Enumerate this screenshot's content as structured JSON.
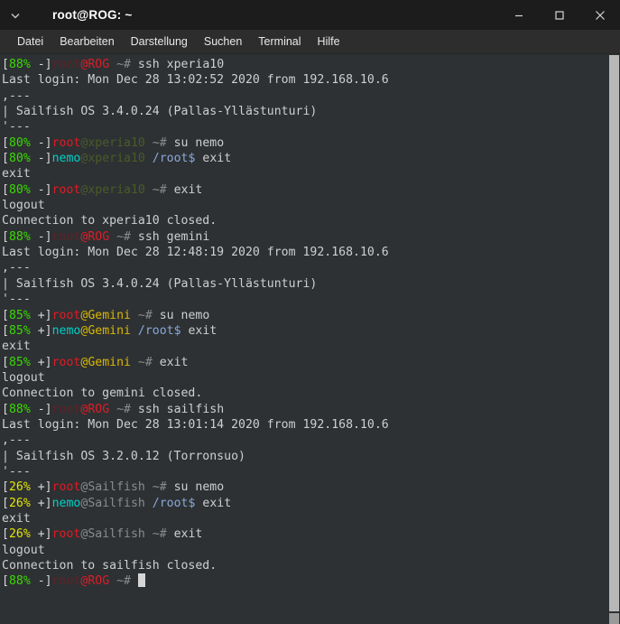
{
  "window": {
    "title": "root@ROG: ~",
    "chevron_icon": "chevron-down-icon",
    "controls": [
      {
        "name": "minimize-button",
        "icon": "minimize-icon"
      },
      {
        "name": "maximize-button",
        "icon": "maximize-icon"
      },
      {
        "name": "close-button",
        "icon": "close-icon"
      }
    ]
  },
  "menubar": {
    "items": [
      {
        "label": "Datei"
      },
      {
        "label": "Bearbeiten"
      },
      {
        "label": "Darstellung"
      },
      {
        "label": "Suchen"
      },
      {
        "label": "Terminal"
      },
      {
        "label": "Hilfe"
      }
    ]
  },
  "terminal": {
    "lines": {
      "l01": {
        "bracket_open": "[",
        "pct": "88%",
        "sep": " -]",
        "user": "root",
        "host": "@ROG",
        "path": " ~# ",
        "cmd": "ssh xperia10"
      },
      "l02": "Last login: Mon Dec 28 13:02:52 2020 from 192.168.10.6",
      "l03": ",---",
      "l04": "| Sailfish OS 3.4.0.24 (Pallas-Yllästunturi)",
      "l05": "'---",
      "l06": {
        "bracket_open": "[",
        "pct": "80%",
        "sep": " -]",
        "user": "root",
        "host": "@xperia10",
        "path": " ~# ",
        "cmd": "su nemo"
      },
      "l07": {
        "bracket_open": "[",
        "pct": "80%",
        "sep": " -]",
        "user": "nemo",
        "host": "@xperia10",
        "path": " /root$ ",
        "cmd": "exit"
      },
      "l08": "exit",
      "l09": {
        "bracket_open": "[",
        "pct": "80%",
        "sep": " -]",
        "user": "root",
        "host": "@xperia10",
        "path": " ~# ",
        "cmd": "exit"
      },
      "l10": "logout",
      "l11": "Connection to xperia10 closed.",
      "l12": {
        "bracket_open": "[",
        "pct": "88%",
        "sep": " -]",
        "user": "root",
        "host": "@ROG",
        "path": " ~# ",
        "cmd": "ssh gemini"
      },
      "l13": "Last login: Mon Dec 28 12:48:19 2020 from 192.168.10.6",
      "l14": ",---",
      "l15": "| Sailfish OS 3.4.0.24 (Pallas-Yllästunturi)",
      "l16": "'---",
      "l17": {
        "bracket_open": "[",
        "pct": "85%",
        "sep": " +]",
        "user": "root",
        "host": "@Gemini",
        "path": " ~# ",
        "cmd": "su nemo"
      },
      "l18": {
        "bracket_open": "[",
        "pct": "85%",
        "sep": " +]",
        "user": "nemo",
        "host": "@Gemini",
        "path": " /root$ ",
        "cmd": "exit"
      },
      "l19": "exit",
      "l20": {
        "bracket_open": "[",
        "pct": "85%",
        "sep": " +]",
        "user": "root",
        "host": "@Gemini",
        "path": " ~# ",
        "cmd": "exit"
      },
      "l21": "logout",
      "l22": "Connection to gemini closed.",
      "l23": {
        "bracket_open": "[",
        "pct": "88%",
        "sep": " -]",
        "user": "root",
        "host": "@ROG",
        "path": " ~# ",
        "cmd": "ssh sailfish"
      },
      "l24": "Last login: Mon Dec 28 13:01:14 2020 from 192.168.10.6",
      "l25": ",---",
      "l26": "| Sailfish OS 3.2.0.12 (Torronsuo)",
      "l27": "'---",
      "l28": {
        "bracket_open": "[",
        "pct": "26%",
        "sep": " +]",
        "user": "root",
        "host": "@Sailfish",
        "path": " ~# ",
        "cmd": "su nemo"
      },
      "l29": {
        "bracket_open": "[",
        "pct": "26%",
        "sep": " +]",
        "user": "nemo",
        "host": "@Sailfish",
        "path": " /root$ ",
        "cmd": "exit"
      },
      "l30": "exit",
      "l31": {
        "bracket_open": "[",
        "pct": "26%",
        "sep": " +]",
        "user": "root",
        "host": "@Sailfish",
        "path": " ~# ",
        "cmd": "exit"
      },
      "l32": "logout",
      "l33": "Connection to sailfish closed.",
      "l34": {
        "bracket_open": "[",
        "pct": "88%",
        "sep": " -]",
        "user": "root",
        "host": "@ROG",
        "path": " ~# ",
        "cmd": ""
      }
    }
  },
  "colors": {
    "background": "#2d3134",
    "titlebar": "#1c1c1c",
    "menubar": "#2d2d2d",
    "foreground": "#d6d6d6",
    "green": "#3ad900",
    "yellow": "#e5e500",
    "red": "#e01b24",
    "cyan": "#00d0c8",
    "scrollbar": "#b8b8b8"
  }
}
